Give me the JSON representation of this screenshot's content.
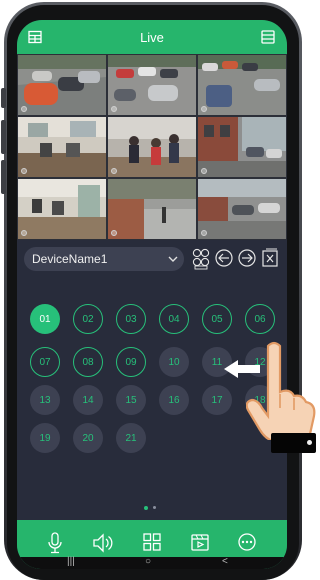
{
  "header": {
    "title": "Live",
    "left_icon": "grid-layout-icon",
    "right_icon": "device-list-icon"
  },
  "cameras": [
    {
      "id": "cam-1",
      "scene": "parking-lot"
    },
    {
      "id": "cam-2",
      "scene": "parking-lot"
    },
    {
      "id": "cam-3",
      "scene": "parking-lot"
    },
    {
      "id": "cam-4",
      "scene": "office-interior"
    },
    {
      "id": "cam-5",
      "scene": "office-people"
    },
    {
      "id": "cam-6",
      "scene": "building-street"
    },
    {
      "id": "cam-7",
      "scene": "office-interior"
    },
    {
      "id": "cam-8",
      "scene": "street-walkway"
    },
    {
      "id": "cam-9",
      "scene": "street-cars"
    }
  ],
  "device_selector": {
    "value": "DeviceName1",
    "chevron": "chevron-down-icon"
  },
  "toolbar_icons": [
    "multi-channel-icon",
    "back-circle-icon",
    "forward-circle-icon",
    "close-box-icon"
  ],
  "channels": {
    "labels": [
      "01",
      "02",
      "03",
      "04",
      "05",
      "06",
      "07",
      "08",
      "09",
      "10",
      "11",
      "12",
      "13",
      "14",
      "15",
      "16",
      "17",
      "18",
      "19",
      "20",
      "21"
    ],
    "active": "01",
    "outlined": [
      "02",
      "03",
      "04",
      "05",
      "06",
      "07",
      "08",
      "09"
    ]
  },
  "pagination": {
    "pages": 2,
    "current": 1
  },
  "bottom_bar": {
    "icons": [
      "microphone-icon",
      "speaker-icon",
      "grid-icon",
      "playback-icon",
      "more-icon"
    ]
  },
  "nav_bar": {
    "buttons": [
      "|||",
      "○",
      "<"
    ]
  },
  "colors": {
    "accent": "#26b56c",
    "panel": "#282c3b",
    "chip": "#3d4152"
  }
}
